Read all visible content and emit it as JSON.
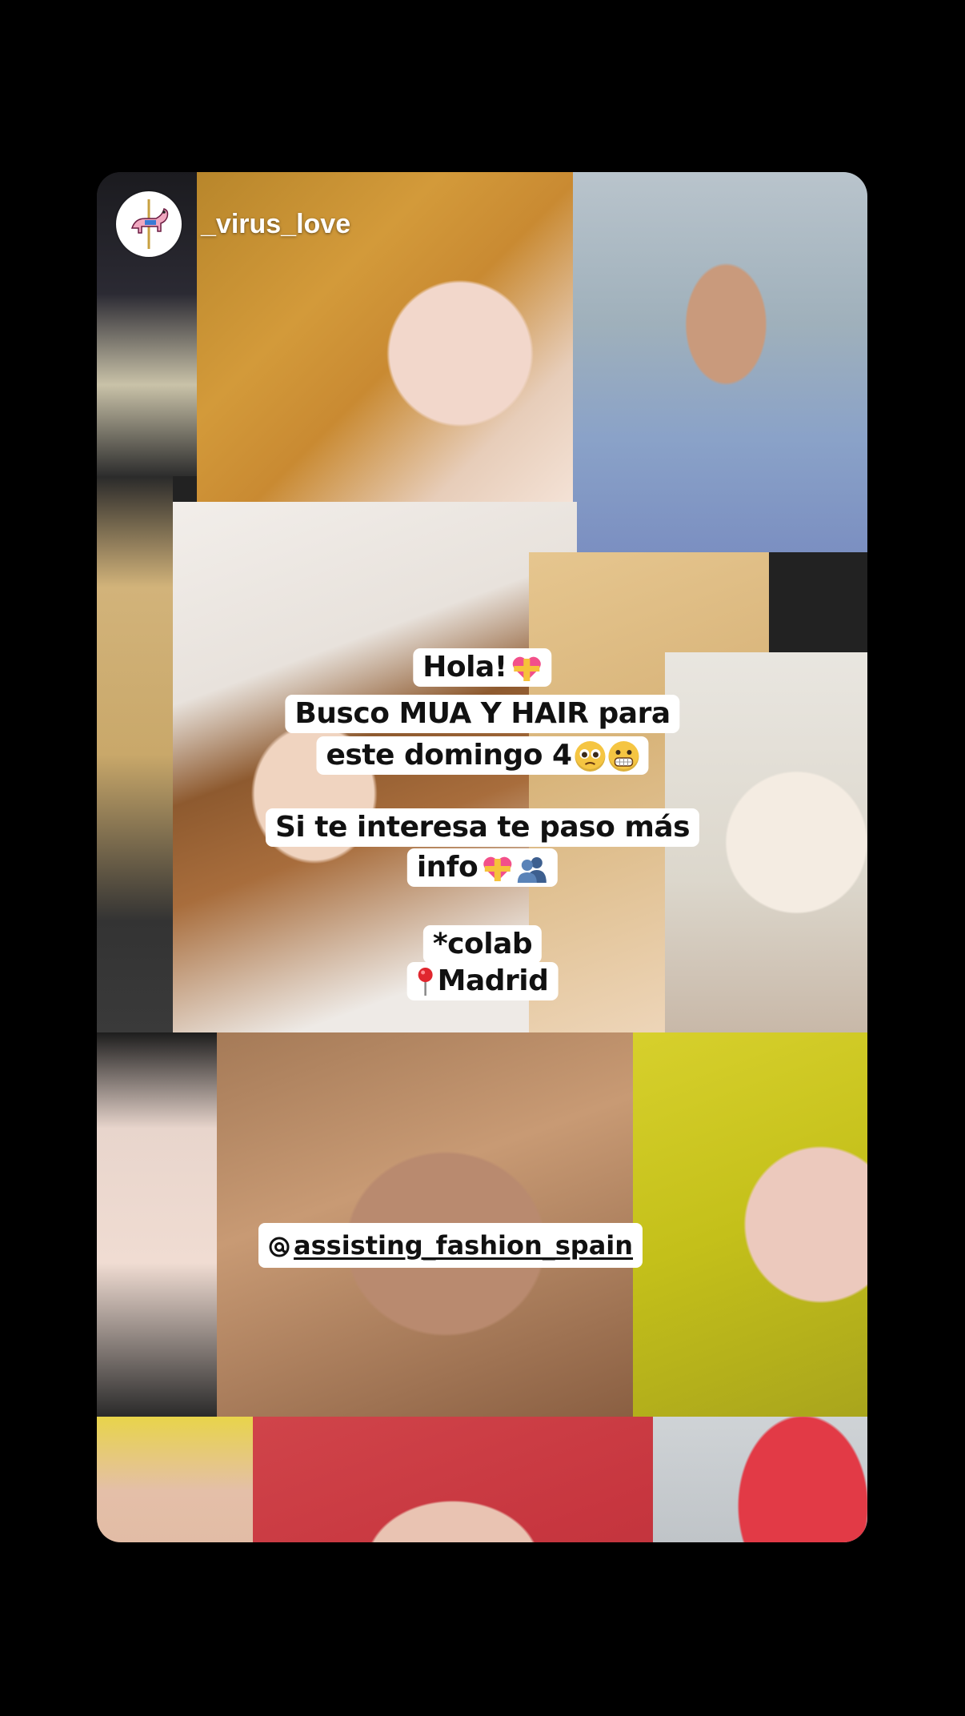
{
  "story": {
    "username": "_virus_love",
    "avatar_icon": "carousel-horse-icon"
  },
  "stickers": {
    "line1": "Hola!",
    "line2": "Busco MUA Y HAIR para",
    "line3": "este domingo 4",
    "line4": "Si te interesa te paso más",
    "line5": "info",
    "line6": "*colab",
    "line7": "Madrid",
    "mention": "assisting_fashion_spain"
  },
  "icons": {
    "heart": "heart-with-ribbon-icon",
    "sad": "pleading-face-icon",
    "grimace": "grimacing-face-icon",
    "people": "busts-in-silhouette-icon",
    "pin": "round-pushpin-icon",
    "at": "threads-at-icon"
  },
  "colors": {
    "background": "#000000",
    "sticker_bg": "#ffffff",
    "text": "#111111"
  }
}
